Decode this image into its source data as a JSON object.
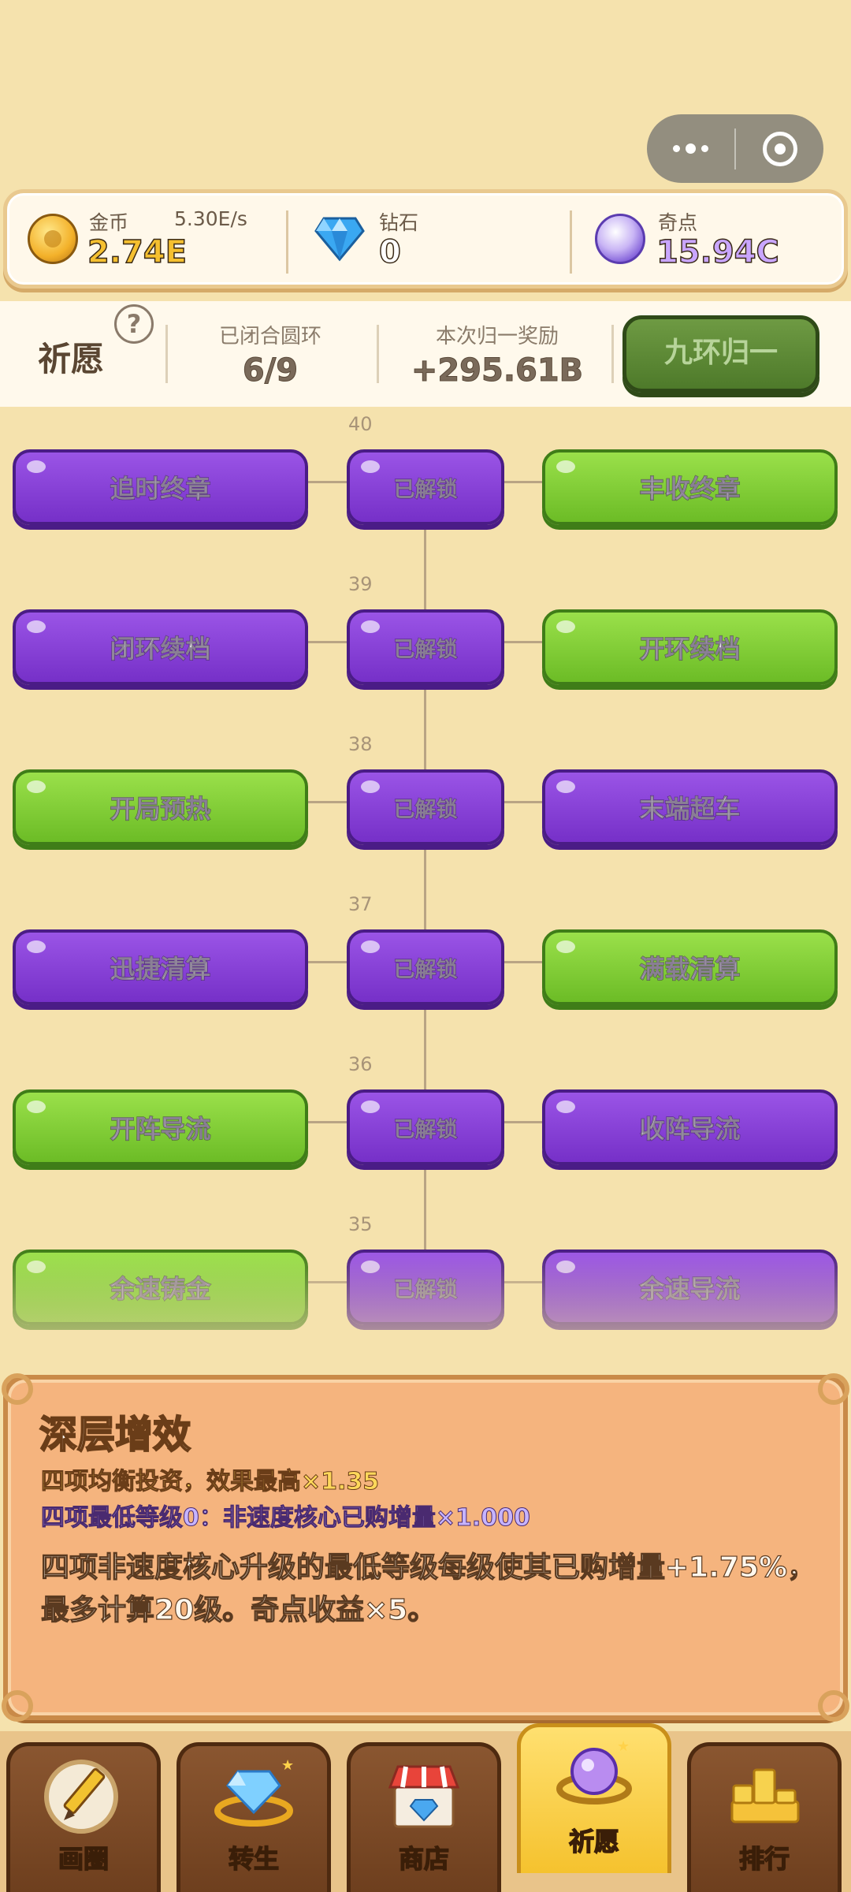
{
  "resources": {
    "coin": {
      "label": "金币",
      "value": "2.74E",
      "rate": "5.30E/s"
    },
    "diamond": {
      "label": "钻石",
      "value": "0"
    },
    "qidian": {
      "label": "奇点",
      "value": "15.94C"
    }
  },
  "wish": {
    "title": "祈愿",
    "help": "?",
    "closed_rings_label": "已闭合圆环",
    "closed_rings_value": "6/9",
    "reward_label": "本次归一奖励",
    "reward_value": "+295.61B",
    "reset_button": "九环归一"
  },
  "tree": {
    "rows": [
      {
        "level": "40",
        "left": "追时终章",
        "left_color": "purple",
        "center": "已解锁",
        "right": "丰收终章",
        "right_color": "green"
      },
      {
        "level": "39",
        "left": "闭环续档",
        "left_color": "purple",
        "center": "已解锁",
        "right": "开环续档",
        "right_color": "green"
      },
      {
        "level": "38",
        "left": "开局预热",
        "left_color": "green",
        "center": "已解锁",
        "right": "末端超车",
        "right_color": "purple"
      },
      {
        "level": "37",
        "left": "迅捷清算",
        "left_color": "purple",
        "center": "已解锁",
        "right": "满载清算",
        "right_color": "green"
      },
      {
        "level": "36",
        "left": "开阵导流",
        "left_color": "green",
        "center": "已解锁",
        "right": "收阵导流",
        "right_color": "purple"
      },
      {
        "level": "35",
        "left": "余速铸金",
        "left_color": "green",
        "center": "已解锁",
        "right": "余速导流",
        "right_color": "purple"
      }
    ]
  },
  "detail": {
    "title": "深层增效",
    "line1": "四项均衡投资，效果最高×1.35",
    "line2": "四项最低等级0：非速度核心已购增量×1.000",
    "description": "四项非速度核心升级的最低等级每级使其已购增量+1.75%，最多计算20级。奇点收益×5。"
  },
  "nav": {
    "tabs": [
      {
        "label": "画圈",
        "icon": "pencil-ring-icon",
        "active": false
      },
      {
        "label": "转生",
        "icon": "diamond-ring-icon",
        "active": false
      },
      {
        "label": "商店",
        "icon": "shop-icon",
        "active": false
      },
      {
        "label": "祈愿",
        "icon": "orb-ring-icon",
        "active": true
      },
      {
        "label": "排行",
        "icon": "podium-icon",
        "active": false
      }
    ]
  },
  "colors": {
    "background": "#f5e2ad",
    "purple_node": "#8a40d8",
    "green_node": "#86d03a",
    "panel": "#f5b47e"
  }
}
